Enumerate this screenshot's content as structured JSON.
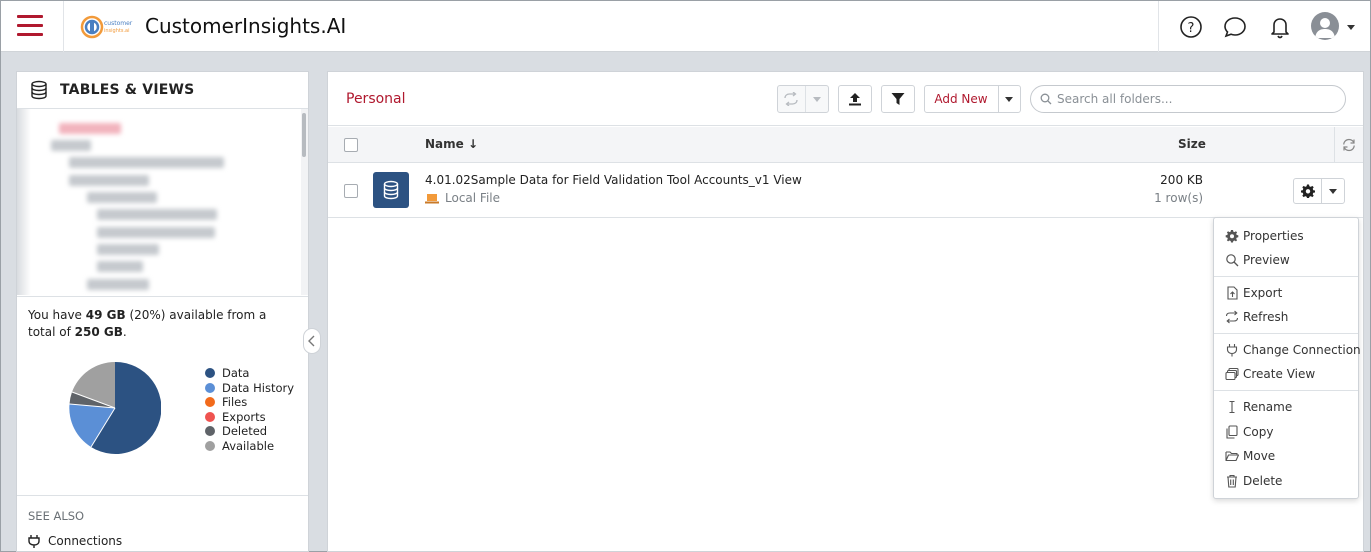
{
  "header": {
    "app_title": "CustomerInsights.AI",
    "logo_text": "Customer Insights.AI"
  },
  "left_panel": {
    "title": "TABLES & VIEWS",
    "storage_text_1": "You have ",
    "storage_available": "49 GB",
    "storage_text_2": " (20%) available from a total of ",
    "storage_total": "250 GB",
    "storage_text_3": ".",
    "legend": [
      {
        "label": "Data",
        "color": "#2c5282"
      },
      {
        "label": "Data History",
        "color": "#5b8fd6"
      },
      {
        "label": "Files",
        "color": "#f26a1b"
      },
      {
        "label": "Exports",
        "color": "#ef5350"
      },
      {
        "label": "Deleted",
        "color": "#5f6368"
      },
      {
        "label": "Available",
        "color": "#a0a0a0"
      }
    ],
    "see_also_label": "SEE ALSO",
    "connections_label": "Connections"
  },
  "main": {
    "title": "Personal",
    "add_new_label": "Add New",
    "search_placeholder": "Search all folders...",
    "columns": {
      "name": "Name ↓",
      "size": "Size"
    },
    "rows": [
      {
        "name": "4.01.02Sample Data for Field Validation Tool Accounts_v1 View",
        "source": "Local File",
        "size": "200 KB",
        "row_count": "1 row(s)"
      }
    ]
  },
  "context_menu": {
    "items": [
      {
        "label": "Properties",
        "icon": "gear-icon"
      },
      {
        "label": "Preview",
        "icon": "search-icon"
      },
      {
        "label": "Export",
        "icon": "export-icon"
      },
      {
        "label": "Refresh",
        "icon": "refresh-icon"
      },
      {
        "label": "Change Connection",
        "icon": "plug-icon"
      },
      {
        "label": "Create View",
        "icon": "stack-icon"
      },
      {
        "label": "Rename",
        "icon": "text-cursor-icon"
      },
      {
        "label": "Copy",
        "icon": "copy-icon"
      },
      {
        "label": "Move",
        "icon": "folder-icon"
      },
      {
        "label": "Delete",
        "icon": "trash-icon"
      }
    ]
  },
  "colors": {
    "brand_red": "#b0182e",
    "data_blue": "#2c5282"
  }
}
